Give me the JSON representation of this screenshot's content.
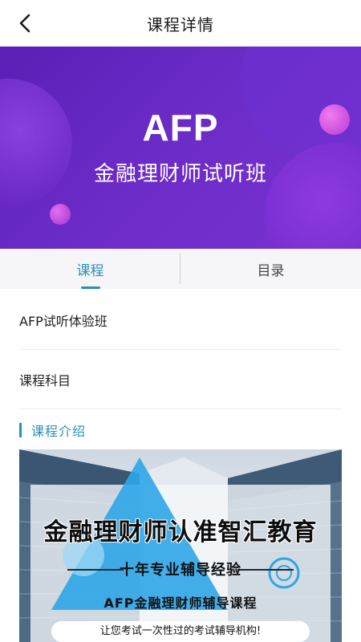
{
  "header": {
    "back_icon": "chevron-left-icon",
    "title": "课程详情"
  },
  "banner": {
    "title": "AFP",
    "subtitle": "金融理财师试听班",
    "colors": {
      "background": "#6b2bc7",
      "accent_circle": "#c94fd6"
    }
  },
  "tabs": [
    {
      "label": "课程",
      "active": true
    },
    {
      "label": "目录",
      "active": false
    }
  ],
  "course": {
    "name": "AFP试听体验班",
    "subject_label": "课程科目"
  },
  "intro": {
    "heading": "课程介绍",
    "promo": {
      "headline": "金融理财师认准智汇教育",
      "line1": "十年专业辅导经验",
      "line2": "AFP金融理财师辅导课程",
      "line3": "让您考试一次性过的考试辅导机构!"
    }
  },
  "colors": {
    "accent": "#2a8fb8"
  }
}
